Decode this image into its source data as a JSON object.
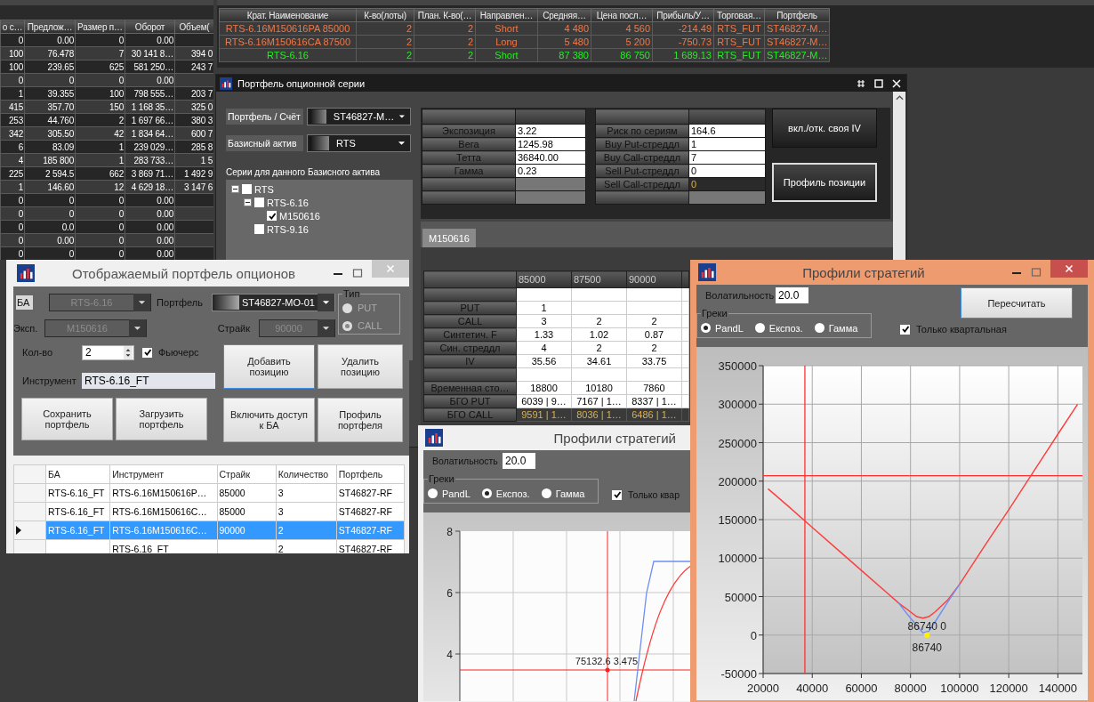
{
  "market_table": {
    "columns": [
      "о с…",
      "Предлож…",
      "Размер п…",
      "Оборот",
      "Объем("
    ],
    "rows": [
      [
        "0",
        "0.00",
        "0",
        "0.00",
        null
      ],
      [
        "100",
        "76.478",
        "7",
        "30 141 8…",
        "394 0"
      ],
      [
        "100",
        "239.65",
        "625",
        "581 250…",
        "243 7"
      ],
      [
        "0",
        "0",
        "0",
        "0.00",
        null
      ],
      [
        "1",
        "39.355",
        "100",
        "798 555…",
        "203 7"
      ],
      [
        "415",
        "357.70",
        "150",
        "1 168 35…",
        "325 0"
      ],
      [
        "253",
        "44.760",
        "2",
        "1 697 66…",
        "380 3"
      ],
      [
        "342",
        "305.50",
        "42",
        "1 834 64…",
        "600 7"
      ],
      [
        "6",
        "83.09",
        "1",
        "239 029…",
        "285 8"
      ],
      [
        "4",
        "185 800",
        "1",
        "283 733…",
        "1 5"
      ],
      [
        "225",
        "2 594.5",
        "662",
        "3 869 71…",
        "1 492 9"
      ],
      [
        "1",
        "146.60",
        "12",
        "4 629 18…",
        "3 147 6"
      ],
      [
        "0",
        "0",
        "0",
        "0.00",
        null
      ],
      [
        "0",
        "0",
        "0",
        "0.00",
        null
      ],
      [
        "0",
        "0.0",
        "0",
        "0.00",
        null
      ],
      [
        "0",
        "0.00",
        "0",
        "0.00",
        null
      ],
      [
        "0",
        "0",
        "0",
        "0.00",
        null
      ]
    ]
  },
  "positions_table": {
    "columns": [
      "Крат. Наименование",
      "К-во(лоты)",
      "План. К-во(…",
      "Направлен…",
      "Средняя…",
      "Цена посл…",
      "Прибыль/У…",
      "Торговая…",
      "Портфель"
    ],
    "rows": [
      {
        "color": "#f07848",
        "cells": [
          "RTS-6.16M150616PA 85000",
          "2",
          "2",
          "Short",
          "4 480",
          "4 560",
          "-214.49",
          "RTS_FUT",
          "ST46827-M…"
        ]
      },
      {
        "color": "#f07848",
        "cells": [
          "RTS-6.16M150616CA 87500",
          "2",
          "2",
          "Long",
          "5 480",
          "5 200",
          "-750.73",
          "RTS_FUT",
          "ST46827-M…"
        ]
      },
      {
        "color": "#22ee22",
        "cells": [
          "RTS-6.16",
          "2",
          "2",
          "Short",
          "87 380",
          "86 750",
          "1 689.13",
          "RTS_FUT",
          "ST46827-M…"
        ]
      }
    ]
  },
  "series_window": {
    "title": "Портфель опционной серии",
    "portfolio": {
      "label": "Портфель / Счёт",
      "value": "ST46827-M…"
    },
    "base_asset": {
      "label": "Базисный актив",
      "value": "RTS"
    },
    "series_caption": "Серии для данного Базисного актива",
    "tree": [
      {
        "label": "RTS",
        "checked": false,
        "expanded": true,
        "children": [
          {
            "label": "RTS-6.16",
            "checked": false,
            "expanded": true,
            "children": [
              {
                "label": "M150616",
                "checked": true
              }
            ]
          },
          {
            "label": "RTS-9.16",
            "checked": false
          }
        ]
      }
    ],
    "greeks": [
      {
        "label": "Экспозиция",
        "value": "3.22"
      },
      {
        "label": "Вега",
        "value": "1245.98"
      },
      {
        "label": "Тетта",
        "value": "36840.00"
      },
      {
        "label": "Гамма",
        "value": "0.23"
      }
    ],
    "risks": [
      {
        "label": "Риск по сериям",
        "value": "164.6",
        "selected": false
      },
      {
        "label": "Buy Put-стреддл",
        "value": "1",
        "selected": false
      },
      {
        "label": "Buy Call-стреддл",
        "value": "7",
        "selected": false
      },
      {
        "label": "Sell Put-стреддл",
        "value": "0",
        "selected": false
      },
      {
        "label": "Sell Call-стреддл",
        "value": "0",
        "selected": true
      }
    ],
    "buttons": [
      {
        "label": "вкл./отк. своя IV",
        "focused": false
      },
      {
        "label": "Профиль позиции",
        "focused": true
      }
    ],
    "tabs": [
      {
        "label": "M150616",
        "selected": true
      }
    ],
    "grid": {
      "columns": [
        "85000",
        "87500",
        "90000"
      ],
      "rows": [
        {
          "kind": "spacer",
          "selected": false
        },
        {
          "kind": "data",
          "label": "PUT",
          "values": [
            "1"
          ],
          "selected": false
        },
        {
          "kind": "data",
          "label": "CALL",
          "values": [
            "3",
            "2",
            "2"
          ],
          "selected": false
        },
        {
          "kind": "data",
          "label": "Синтетич. F",
          "values": [
            "1.33",
            "1.02",
            "0.87"
          ],
          "selected": false
        },
        {
          "kind": "data",
          "label": "Син. стреддл",
          "values": [
            "4",
            "2",
            "2"
          ],
          "selected": false
        },
        {
          "kind": "data",
          "label": "IV",
          "values": [
            "35.56",
            "34.61",
            "33.75"
          ],
          "selected": false
        },
        {
          "kind": "spacer",
          "selected": false
        },
        {
          "kind": "data",
          "label": "Временная сто…",
          "values": [
            "18800",
            "10180",
            "7860"
          ],
          "selected": false
        },
        {
          "kind": "data",
          "label": "БГО PUT",
          "values": [
            "6039 | 9…",
            "7167 | 1…",
            "8337 | 1…"
          ],
          "selected": false
        },
        {
          "kind": "data",
          "label": "БГО CALL",
          "values": [
            "9591 | 1…",
            "8036 | 1…",
            "6486 | 1…"
          ],
          "selected": true
        }
      ]
    }
  },
  "portfolio_window": {
    "title": "Отображаемый портфель опционов",
    "active": false,
    "ba": {
      "label": "БА",
      "value": "RTS-6.16",
      "disabled": true
    },
    "expiry": {
      "label": "Эксп.",
      "value": "M150616",
      "disabled": true
    },
    "portfolio": {
      "label": "Портфель",
      "value": "ST46827-MO-01",
      "disabled": false
    },
    "strike": {
      "label": "Страйк",
      "value": "90000",
      "disabled": true
    },
    "type_group": {
      "label": "Тип",
      "disabled": true,
      "options": [
        {
          "label": "PUT",
          "selected": false
        },
        {
          "label": "CALL",
          "selected": true
        }
      ]
    },
    "quantity": {
      "label": "Кол-во",
      "value": "2"
    },
    "futures": {
      "label": "Фьючерс",
      "checked": true
    },
    "instrument": {
      "label": "Инструмент",
      "value": "RTS-6.16_FT"
    },
    "action_buttons": [
      {
        "label": "Добавить позицию",
        "focused": true
      },
      {
        "label": "Удалить позицию",
        "focused": false
      }
    ],
    "bottom_buttons": [
      {
        "label": "Сохранить портфель"
      },
      {
        "label": "Загрузить портфель"
      },
      {
        "label": "Включить доступ к БА"
      },
      {
        "label": "Профиль портфеля"
      }
    ],
    "table": {
      "columns": [
        "БА",
        "Инструмент",
        "Страйк",
        "Количество",
        "Портфель"
      ],
      "rows": [
        {
          "selected": false,
          "cells": [
            "RTS-6.16_FT",
            "RTS-6.16M150616P…",
            "85000",
            "3",
            "ST46827-RF"
          ]
        },
        {
          "selected": false,
          "cells": [
            "RTS-6.16_FT",
            "RTS-6.16M150616C…",
            "85000",
            "3",
            "ST46827-RF"
          ]
        },
        {
          "selected": true,
          "cells": [
            "RTS-6.16_FT",
            "RTS-6.16M150616C…",
            "90000",
            "2",
            "ST46827-RF"
          ]
        },
        {
          "selected": false,
          "cells": [
            null,
            "RTS-6.16_FT",
            null,
            "2",
            "ST46827-RF"
          ]
        }
      ]
    }
  },
  "strategy_back": {
    "title": "Профили стратегий",
    "active": false,
    "volatility": {
      "label": "Волатильность",
      "value": "20.0"
    },
    "greeks": {
      "label": "Греки",
      "options": [
        {
          "label": "PandL",
          "selected": false
        },
        {
          "label": "Експоз.",
          "selected": true
        },
        {
          "label": "Гамма",
          "selected": false
        }
      ]
    },
    "quarterly": {
      "label": "Только квар",
      "checked": true
    },
    "chart": {
      "y_ticks": [
        "8",
        "6",
        "4"
      ],
      "marker_label": "75132.6 3.475"
    }
  },
  "strategy_front": {
    "title": "Профили стратегий",
    "active": true,
    "volatility": {
      "label": "Волатильность",
      "value": "20.0"
    },
    "greeks": {
      "label": "Греки",
      "options": [
        {
          "label": "PandL",
          "selected": true
        },
        {
          "label": "Експоз.",
          "selected": false
        },
        {
          "label": "Гамма",
          "selected": false
        }
      ]
    },
    "recalc_button": "Пересчитать",
    "quarterly": {
      "label": "Только квартальная",
      "checked": true
    },
    "chart": {
      "chart_data": {
        "type": "line",
        "x": [
          22000,
          30000,
          40000,
          50000,
          60000,
          70000,
          75000,
          80000,
          82500,
          85000,
          87500,
          90000,
          95000,
          100000,
          110000,
          120000,
          130000,
          140000,
          148000
        ],
        "series": [
          {
            "color": "#ff3b3b",
            "values": [
              190000,
              168000,
              140000,
              112000,
              84000,
              56000,
              42000,
              30000,
              24000,
              22000,
              24000,
              30000,
              45000,
              66000,
              115000,
              163000,
              212000,
              261000,
              300000
            ]
          },
          {
            "color": "#6f8ff0",
            "values": [
              null,
              null,
              null,
              null,
              null,
              null,
              42000,
              22000,
              13000,
              3000,
              5000,
              17000,
              42000,
              66000,
              null,
              null,
              null,
              null,
              null
            ]
          }
        ],
        "grid": true,
        "xlim": [
          20000,
          150000
        ],
        "ylim": [
          -50000,
          350000
        ],
        "xticks": [
          20000,
          40000,
          60000,
          80000,
          100000,
          120000,
          140000
        ],
        "yticks": [
          -50000,
          0,
          50000,
          100000,
          150000,
          200000,
          250000,
          300000,
          350000
        ],
        "ref_lines": [
          {
            "axis": "x",
            "value": 37000
          },
          {
            "axis": "y",
            "value": 207000
          }
        ],
        "annotations": [
          {
            "x": 86740,
            "y": 0,
            "text": "86740 0"
          },
          {
            "x": 86740,
            "y": 0,
            "text": "86740"
          }
        ]
      }
    }
  }
}
